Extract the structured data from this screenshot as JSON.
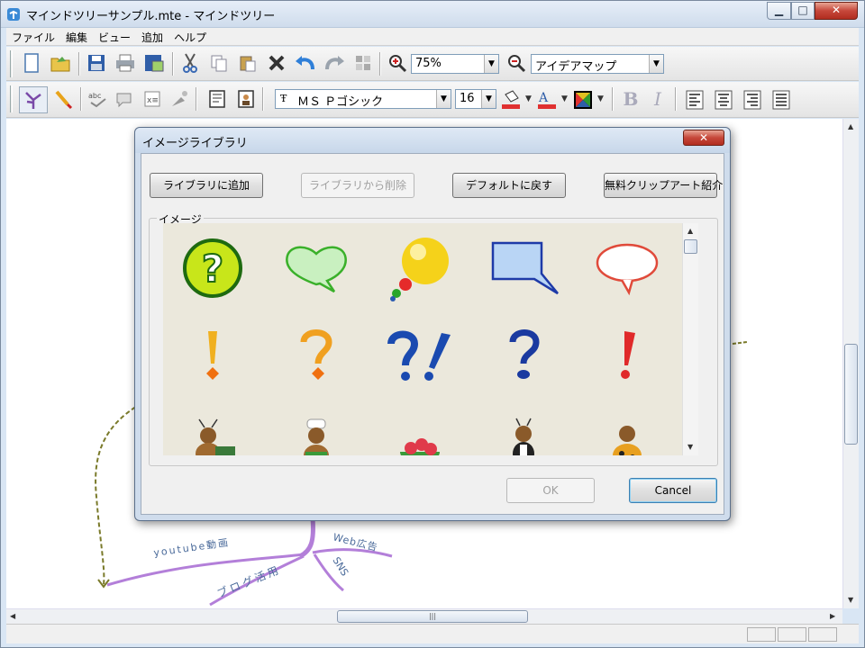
{
  "window": {
    "title": "マインドツリーサンプル.mte - マインドツリー"
  },
  "menubar": [
    "ファイル",
    "編集",
    "ビュー",
    "追加",
    "ヘルプ"
  ],
  "toolbar": {
    "zoom_value": "75%",
    "view_mode": "アイデアマップ",
    "font_name": "ＭＳ Ｐゴシック",
    "font_size": "16",
    "bold_label": "B",
    "italic_label": "I"
  },
  "mindmap": {
    "branch_color": "#b37fd9",
    "arrow_color": "#7a7a2a",
    "labels": {
      "youtube": "youtube動画",
      "blog": "ブログ活用",
      "web_ad": "Web広告",
      "sns": "SNS"
    }
  },
  "dialog": {
    "title": "イメージライブラリ",
    "buttons": {
      "add": "ライブラリに追加",
      "remove": "ライブラリから削除",
      "default": "デフォルトに戻す",
      "clipart": "無料クリップアート紹介",
      "ok": "OK",
      "cancel": "Cancel"
    },
    "group_label": "イメージ",
    "images": [
      "question-circle-icon",
      "heart-speech-bubble-icon",
      "yellow-balloon-icon",
      "blue-square-speech-bubble-icon",
      "red-oval-speech-bubble-icon",
      "orange-exclamation-icon",
      "orange-question-icon",
      "blue-question-exclamation-icon",
      "blue-question-icon",
      "red-exclamation-icon",
      "ant-reading-icon",
      "ant-chef-icon",
      "strawberry-bowl-icon",
      "ant-waiter-icon",
      "ladybug-icon"
    ]
  },
  "colors": {
    "accent_blue": "#1e5fb4",
    "close_red": "#c6473a"
  }
}
